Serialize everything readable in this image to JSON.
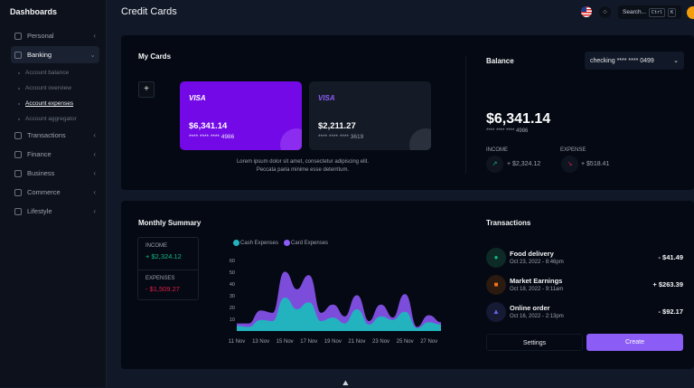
{
  "sidebar": {
    "title": "Dashboards",
    "items": [
      {
        "label": "Personal",
        "icon": "user-icon"
      },
      {
        "label": "Banking",
        "icon": "bank-icon",
        "active": true,
        "children": [
          "Account balance",
          "Account overview",
          "Account expenses",
          "Account aggregator"
        ],
        "active_child": "Account expenses"
      },
      {
        "label": "Transactions",
        "icon": "transactions-icon"
      },
      {
        "label": "Finance",
        "icon": "finance-icon"
      },
      {
        "label": "Business",
        "icon": "business-icon"
      },
      {
        "label": "Commerce",
        "icon": "commerce-icon"
      },
      {
        "label": "Lifestyle",
        "icon": "lifestyle-icon"
      }
    ]
  },
  "header": {
    "title": "Credit Cards",
    "search_placeholder": "Search...",
    "kbd1": "Ctrl",
    "kbd2": "K"
  },
  "my_cards": {
    "title": "My Cards",
    "add": "+",
    "cards": [
      {
        "brand": "VISA",
        "amount": "$6,341.14",
        "number": "**** **** **** 4986",
        "color": "#7209e6"
      },
      {
        "brand": "VISA",
        "amount": "$2,211.27",
        "number": "**** **** **** 3619",
        "color": "#141b26"
      }
    ],
    "text1": "Lorem ipsum dolor sit amet, consectetur adipiscing elit.",
    "text2": "Peccata paria minime esse deterritum."
  },
  "balance": {
    "title": "Balance",
    "account": "checking **** **** 0499",
    "amount": "$6,341.14",
    "number": "**** **** **** 4986",
    "income_label": "INCOME",
    "income": "+ $2,324.12",
    "expense_label": "EXPENSE",
    "expense": "+ $518.41"
  },
  "summary": {
    "title": "Monthly Summary",
    "income_label": "INCOME",
    "income": "+ $2,324.12",
    "expenses_label": "EXPENSES",
    "expenses": "- $1,509.27"
  },
  "chart_data": {
    "type": "area",
    "stacked": true,
    "x": [
      "11 Nov",
      "12 Nov",
      "13 Nov",
      "14 Nov",
      "15 Nov",
      "16 Nov",
      "17 Nov",
      "18 Nov",
      "19 Nov",
      "20 Nov",
      "21 Nov",
      "22 Nov",
      "23 Nov",
      "24 Nov",
      "25 Nov",
      "26 Nov",
      "27 Nov",
      "28 Nov"
    ],
    "xticks": [
      "11 Nov",
      "13 Nov",
      "15 Nov",
      "17 Nov",
      "19 Nov",
      "21 Nov",
      "23 Nov",
      "25 Nov",
      "27 Nov"
    ],
    "yticks": [
      10,
      20,
      30,
      40,
      50,
      60
    ],
    "ylim": [
      0,
      60
    ],
    "legend": "top-left",
    "series": [
      {
        "name": "Cash Expenses",
        "color": "#22b3bf",
        "values": [
          4,
          3,
          9,
          8,
          28,
          18,
          24,
          8,
          11,
          6,
          18,
          5,
          12,
          9,
          16,
          2,
          7,
          5
        ]
      },
      {
        "name": "Card Expenses",
        "color": "#7c4ddb",
        "values": [
          2,
          3,
          8,
          7,
          22,
          17,
          23,
          7,
          11,
          6,
          12,
          3,
          10,
          2,
          15,
          1,
          6,
          2
        ]
      }
    ]
  },
  "transactions": {
    "title": "Transactions",
    "items": [
      {
        "name": "Food delivery",
        "date": "Oct 23, 2022 - 8:46pm",
        "amount": "- $41.49",
        "color": "#10b981",
        "bg": "#0d2a26"
      },
      {
        "name": "Market Earnings",
        "date": "Oct 18, 2022 - 9:11am",
        "amount": "+ $263.39",
        "color": "#f97316",
        "bg": "#2a1a10"
      },
      {
        "name": "Online order",
        "date": "Oct 16, 2022 - 2:13pm",
        "amount": "- $92.17",
        "color": "#6366f1",
        "bg": "#171a33"
      }
    ],
    "settings": "Settings",
    "create": "Create"
  },
  "colors": {
    "accent": "#8b5cf6",
    "income": "#10b981",
    "expense": "#e11d48"
  }
}
